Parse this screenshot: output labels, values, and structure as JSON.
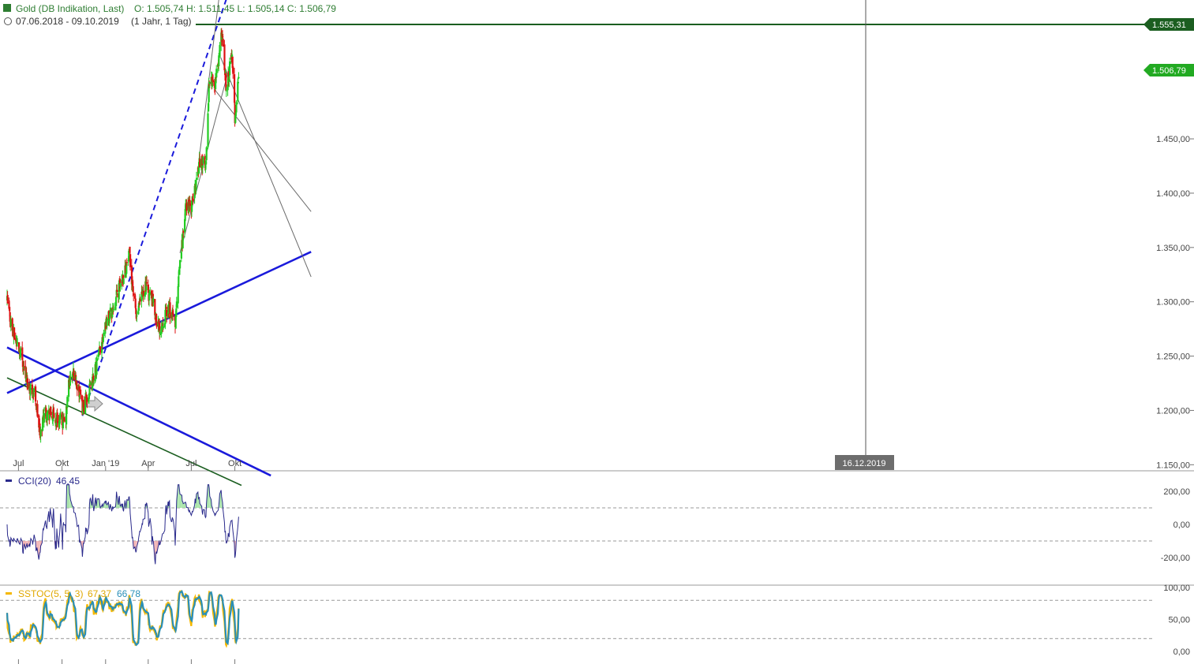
{
  "header": {
    "title": "Gold (DB Indikation, Last)",
    "ohlc": "O: 1.505,74  H: 1.511,45  L: 1.505,14  C: 1.506,79",
    "range": "07.06.2018 - 09.10.2019",
    "period": "(1 Jahr, 1 Tag)"
  },
  "price_badges": {
    "resistance": "1.555,31",
    "last": "1.506,79"
  },
  "crosshair_date": "16.12.2019",
  "x_ticks": [
    "Jul",
    "Okt",
    "Jan '19",
    "Apr",
    "Jul",
    "Okt"
  ],
  "y_ticks_price": [
    "1.150,00",
    "1.200,00",
    "1.250,00",
    "1.300,00",
    "1.350,00",
    "1.400,00",
    "1.450,00"
  ],
  "y_ticks_cci": [
    "200,00",
    "0,00",
    "-200,00"
  ],
  "y_ticks_stoch": [
    "100,00",
    "50,00",
    "0,00"
  ],
  "cci": {
    "label": "CCI(20)",
    "value": "46,45"
  },
  "stoch": {
    "label": "SSTOC(5, 5, 3)",
    "k_value": "67,37",
    "d_value": "66,78"
  },
  "colors": {
    "up": "#22cc22",
    "down": "#dd1111",
    "blue": "#1a1adb",
    "green": "#1b5e20",
    "cci_line": "#2a2a8c",
    "stoch_k": "#f5b800",
    "stoch_d": "#2a8fb8"
  },
  "chart_data": [
    {
      "type": "candlestick",
      "x_range": [
        "07.06.2018",
        "09.10.2019"
      ],
      "ylim": [
        1130,
        1575
      ],
      "close_path_anchors": [
        [
          "2018-06-07",
          1300
        ],
        [
          "2018-06-20",
          1270
        ],
        [
          "2018-07-05",
          1255
        ],
        [
          "2018-07-20",
          1225
        ],
        [
          "2018-08-05",
          1215
        ],
        [
          "2018-08-16",
          1175
        ],
        [
          "2018-08-24",
          1200
        ],
        [
          "2018-09-10",
          1195
        ],
        [
          "2018-09-25",
          1190
        ],
        [
          "2018-10-08",
          1188
        ],
        [
          "2018-10-15",
          1225
        ],
        [
          "2018-10-26",
          1235
        ],
        [
          "2018-11-13",
          1202
        ],
        [
          "2018-11-30",
          1220
        ],
        [
          "2018-12-15",
          1245
        ],
        [
          "2018-12-31",
          1280
        ],
        [
          "2019-01-15",
          1292
        ],
        [
          "2019-01-31",
          1315
        ],
        [
          "2019-02-20",
          1342
        ],
        [
          "2019-03-07",
          1285
        ],
        [
          "2019-03-25",
          1315
        ],
        [
          "2019-04-10",
          1300
        ],
        [
          "2019-04-24",
          1275
        ],
        [
          "2019-05-14",
          1295
        ],
        [
          "2019-05-28",
          1280
        ],
        [
          "2019-06-07",
          1335
        ],
        [
          "2019-06-20",
          1390
        ],
        [
          "2019-07-01",
          1385
        ],
        [
          "2019-07-18",
          1430
        ],
        [
          "2019-07-31",
          1425
        ],
        [
          "2019-08-08",
          1505
        ],
        [
          "2019-08-20",
          1500
        ],
        [
          "2019-09-04",
          1548
        ],
        [
          "2019-09-13",
          1495
        ],
        [
          "2019-09-24",
          1530
        ],
        [
          "2019-10-01",
          1470
        ],
        [
          "2019-10-09",
          1506.79
        ]
      ],
      "last": {
        "open": 1505.74,
        "high": 1511.45,
        "low": 1505.14,
        "close": 1506.79
      },
      "horizontal_line": 1555.31,
      "trendlines": [
        {
          "style": "solid",
          "color": "blue",
          "from": [
            "2018-06-07",
            1216
          ],
          "to": [
            "2020-03-10",
            1346
          ]
        },
        {
          "style": "solid",
          "color": "blue",
          "from": [
            "2018-06-07",
            1258
          ],
          "to": [
            "2019-12-16",
            1140
          ]
        },
        {
          "style": "solid",
          "color": "green",
          "from": [
            "2018-06-07",
            1230
          ],
          "to": [
            "2019-10-15",
            1131
          ]
        },
        {
          "style": "dashed",
          "color": "blue",
          "from": [
            "2018-11-13",
            1195
          ],
          "to": [
            "2019-09-30",
            1600
          ]
        },
        {
          "style": "thin",
          "color": "gray",
          "from": [
            "2019-07-17",
            1430
          ],
          "to": [
            "2019-08-30",
            1585
          ]
        },
        {
          "style": "thin",
          "color": "gray",
          "from": [
            "2019-06-07",
            1345
          ],
          "to": [
            "2019-09-25",
            1525
          ]
        },
        {
          "style": "thin",
          "color": "gray",
          "from": [
            "2019-09-01",
            1525
          ],
          "to": [
            "2020-03-10",
            1323
          ]
        },
        {
          "style": "thin",
          "color": "gray",
          "from": [
            "2019-08-20",
            1495
          ],
          "to": [
            "2020-03-10",
            1383
          ]
        }
      ]
    },
    {
      "type": "line",
      "name": "CCI(20)",
      "ylim": [
        -250,
        250
      ],
      "threshold_lines": [
        100,
        -100
      ],
      "last": 46.45
    },
    {
      "type": "line",
      "name": "SSTOC(5, 5, 3)",
      "ylim": [
        0,
        100
      ],
      "threshold_lines": [
        80,
        20
      ],
      "last_k": 67.37,
      "last_d": 66.78
    }
  ]
}
